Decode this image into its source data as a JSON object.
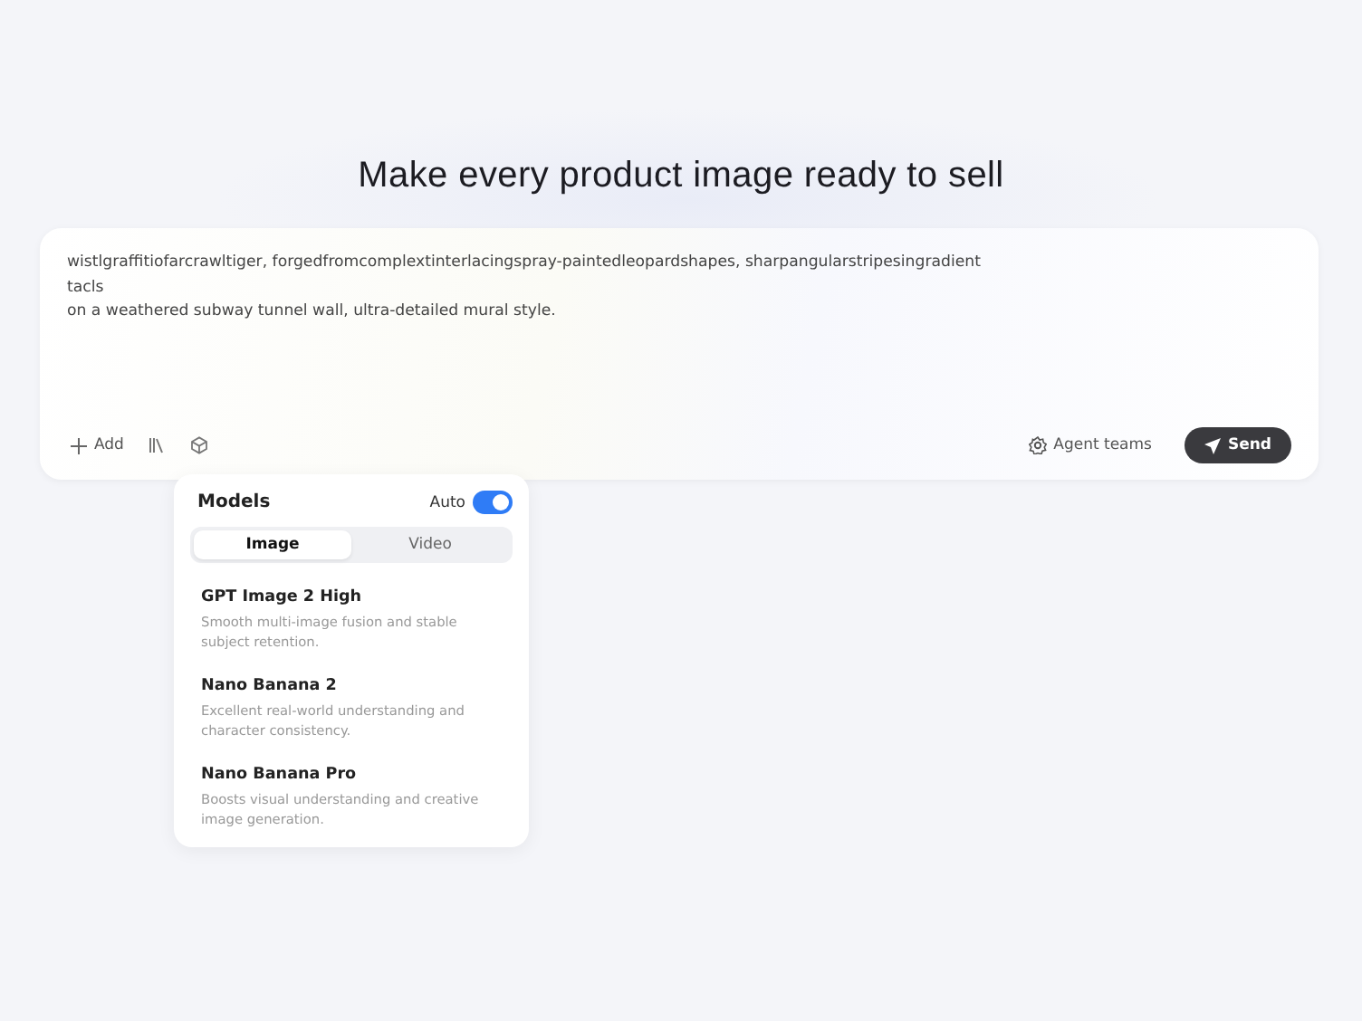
{
  "heading": "Make every product image ready to sell",
  "prompt": {
    "lines": [
      "wistlgraffitiofarcrawltiger, forgedfromcomplextinterlacingspray-paintedleopardshapes, sharpangularstripesingradient",
      "tacls",
      "on a weathered subway tunnel wall, ultra-detailed mural style."
    ]
  },
  "toolbar": {
    "add": "Add",
    "agent": "Agent teams",
    "send": "Send"
  },
  "models": {
    "title": "Models",
    "auto_label": "Auto",
    "auto": true,
    "tabs": [
      {
        "label": "Image",
        "selected": true
      },
      {
        "label": "Video",
        "selected": false
      }
    ],
    "items": [
      {
        "name": "GPT Image 2 High",
        "description": "Smooth multi-image fusion and stable subject retention."
      },
      {
        "name": "Nano Banana 2",
        "description": "Excellent real-world understanding and character consistency."
      },
      {
        "name": "Nano Banana Pro",
        "description": "Boosts visual understanding and creative image generation."
      }
    ]
  }
}
